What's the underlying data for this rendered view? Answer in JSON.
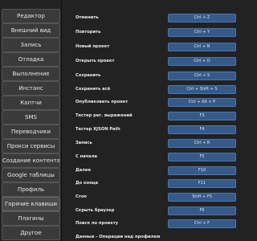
{
  "sidebar": {
    "items": [
      {
        "label": "Редактор"
      },
      {
        "label": "Внешний вид"
      },
      {
        "label": "Запись"
      },
      {
        "label": "Отладка"
      },
      {
        "label": "Выполнение"
      },
      {
        "label": "Инстанс"
      },
      {
        "label": "Каптчи"
      },
      {
        "label": "SMS"
      },
      {
        "label": "Переводчики"
      },
      {
        "label": "Прокси сервисы"
      },
      {
        "label": "Создание контента"
      },
      {
        "label": "Google таблицы"
      },
      {
        "label": "Профиль"
      },
      {
        "label": "Горячие клавиши"
      },
      {
        "label": "Плагины"
      },
      {
        "label": "Другое"
      }
    ]
  },
  "hotkeys": {
    "rows": [
      {
        "label": "Отменить",
        "key": "Ctrl + Z"
      },
      {
        "label": "Повторить",
        "key": "Ctrl + Y"
      },
      {
        "label": "Новый проект",
        "key": "Ctrl + N"
      },
      {
        "label": "Открыть проект",
        "key": "Ctrl + O"
      },
      {
        "label": "Сохранить",
        "key": "Ctrl + S"
      },
      {
        "label": "Сохранить всё",
        "key": "Ctrl + Shift + S"
      },
      {
        "label": "Опубликовать проект",
        "key": "Ctrl + Alt + P"
      },
      {
        "label": "Тестер рег. выражений",
        "key": "F3"
      },
      {
        "label": "Тестер XJSON Path",
        "key": "F4"
      },
      {
        "label": "Запись",
        "key": "Ctrl + R"
      },
      {
        "label": "С начала",
        "key": "F5"
      },
      {
        "label": "Далее",
        "key": "F10"
      },
      {
        "label": "До конца",
        "key": "F11"
      },
      {
        "label": "Стоп",
        "key": "Shift + F5"
      },
      {
        "label": "Скрыть браузер",
        "key": "F6"
      },
      {
        "label": "Поиск по проекту",
        "key": "Ctrl + F"
      },
      {
        "label": "Данные - Операции над профилем",
        "key": ""
      }
    ]
  }
}
